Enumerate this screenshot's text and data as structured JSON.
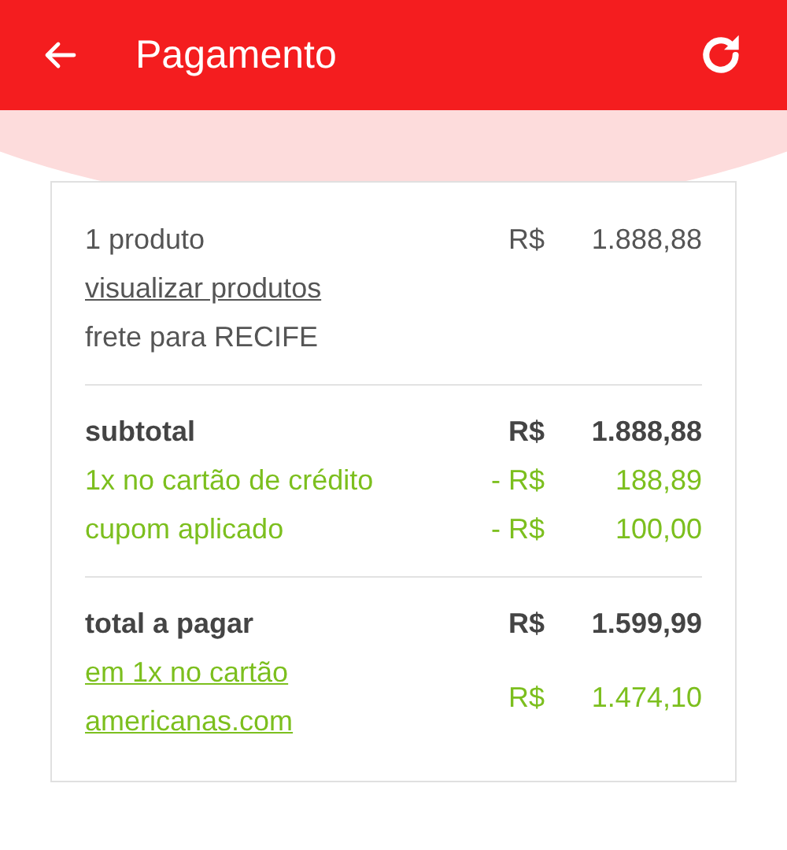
{
  "header": {
    "title": "Pagamento"
  },
  "sections": [
    {
      "rows": [
        {
          "kind": "item",
          "label": "1 produto",
          "currency": "R$",
          "amount": "1.888,88"
        },
        {
          "kind": "link",
          "label": "visualizar produtos"
        },
        {
          "kind": "note",
          "label": "frete para RECIFE"
        }
      ]
    },
    {
      "rows": [
        {
          "kind": "total",
          "label": "subtotal",
          "currency": "R$",
          "amount": "1.888,88"
        },
        {
          "kind": "discount",
          "label": "1x no cartão de crédito",
          "currency": "- R$",
          "amount": "188,89"
        },
        {
          "kind": "discount",
          "label": "cupom aplicado",
          "currency": "- R$",
          "amount": "100,00"
        }
      ]
    },
    {
      "rows": [
        {
          "kind": "total",
          "label": "total a pagar",
          "currency": "R$",
          "amount": "1.599,99"
        },
        {
          "kind": "payment",
          "label_lines": [
            "em 1x no cartão",
            "americanas.com"
          ],
          "currency": "R$",
          "amount": "1.474,10"
        }
      ]
    }
  ]
}
